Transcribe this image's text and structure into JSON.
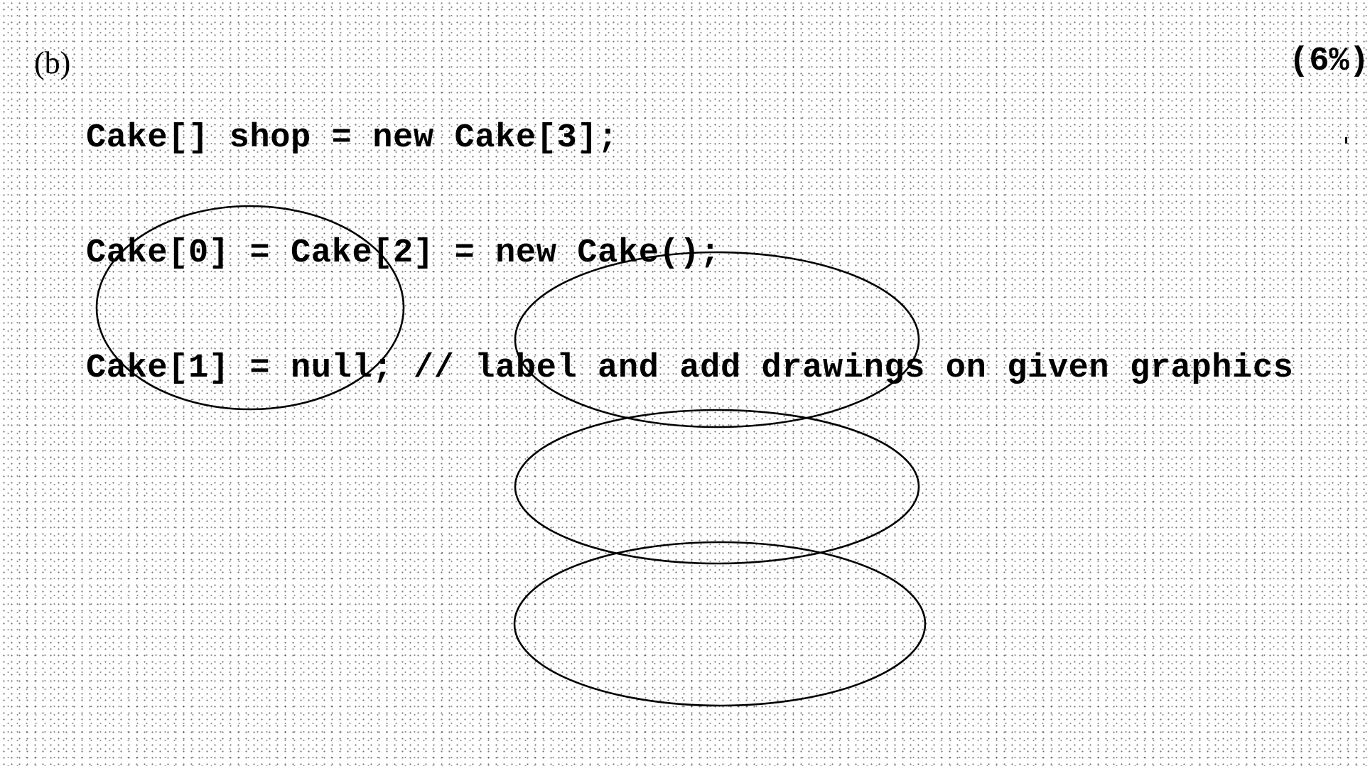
{
  "question": {
    "label": "(b)",
    "points": "(6%)",
    "code_lines": [
      "Cake[] shop = new Cake[3];",
      "Cake[0] = Cake[2] = new Cake();",
      "Cake[1] = null; // label and add drawings on given graphics"
    ]
  },
  "drawings": [
    {
      "name": "standalone-ellipse"
    },
    {
      "name": "stacked-ellipse-top"
    },
    {
      "name": "stacked-ellipse-middle"
    },
    {
      "name": "stacked-ellipse-bottom"
    }
  ]
}
